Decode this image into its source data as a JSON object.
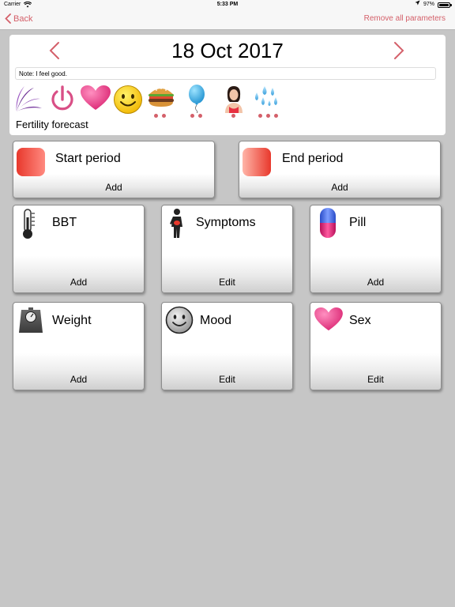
{
  "status_bar": {
    "carrier": "Carrier",
    "time": "5:33 PM",
    "battery": "97%",
    "battery_level": 0.97
  },
  "nav": {
    "back_label": "Back",
    "remove_label": "Remove all parameters"
  },
  "header": {
    "date": "18 Oct 2017",
    "note": "Note: I feel good.",
    "forecast_label": "Fertility forecast",
    "icons": [
      {
        "name": "fertility-leaves-icon",
        "dots": 0
      },
      {
        "name": "power-icon",
        "dots": 0
      },
      {
        "name": "heart-icon",
        "dots": 0
      },
      {
        "name": "smiley-icon",
        "dots": 0
      },
      {
        "name": "burger-icon",
        "dots": 2
      },
      {
        "name": "balloon-icon",
        "dots": 2
      },
      {
        "name": "woman-icon",
        "dots": 1
      },
      {
        "name": "drops-icon",
        "dots": 3
      }
    ]
  },
  "tiles": {
    "start_period": {
      "label": "Start period",
      "action": "Add",
      "icon": "period-start-icon"
    },
    "end_period": {
      "label": "End period",
      "action": "Add",
      "icon": "period-end-icon"
    },
    "bbt": {
      "label": "BBT",
      "action": "Add",
      "icon": "thermometer-icon"
    },
    "symptoms": {
      "label": "Symptoms",
      "action": "Edit",
      "icon": "symptoms-person-icon"
    },
    "pill": {
      "label": "Pill",
      "action": "Add",
      "icon": "pill-icon"
    },
    "weight": {
      "label": "Weight",
      "action": "Add",
      "icon": "scale-icon"
    },
    "mood": {
      "label": "Mood",
      "action": "Edit",
      "icon": "mood-face-icon"
    },
    "sex": {
      "label": "Sex",
      "action": "Edit",
      "icon": "heart-icon"
    }
  },
  "colors": {
    "accent": "#d4606a",
    "background": "#c6c6c6",
    "period_red": "#e8382c",
    "heart_pink": "#e0307a"
  }
}
